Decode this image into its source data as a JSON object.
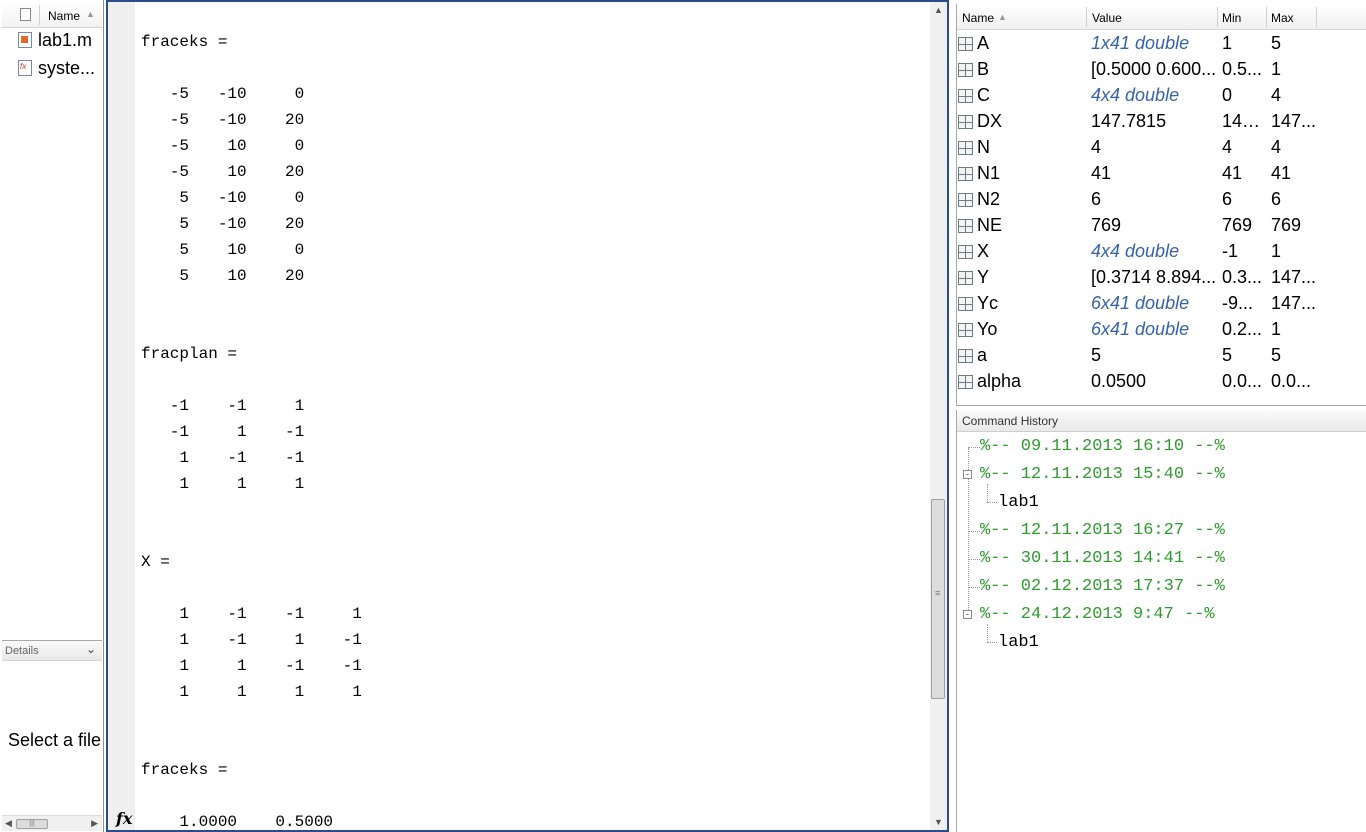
{
  "current_folder": {
    "header": {
      "name_col": "Name",
      "sort_arrow": "▲"
    },
    "files": [
      {
        "name": "lab1.m",
        "icon": "m-file-icon"
      },
      {
        "name": "syste...",
        "icon": "function-file-icon"
      }
    ],
    "details": {
      "label": "Details",
      "chevron": "⌄",
      "message": "Select a file"
    },
    "hscroll": {
      "left_arrow": "◀",
      "right_arrow": "▶",
      "grip": "|||"
    }
  },
  "command_window": {
    "prompt_icon": "fx",
    "lines": [
      {
        "text": "fraceks ="
      },
      {
        "text": "   -5   -10     0"
      },
      {
        "text": "   -5   -10    20"
      },
      {
        "text": "   -5    10     0"
      },
      {
        "text": "   -5    10    20"
      },
      {
        "text": "    5   -10     0"
      },
      {
        "text": "    5   -10    20"
      },
      {
        "text": "    5    10     0"
      },
      {
        "text": "    5    10    20"
      },
      {
        "text": "fracplan ="
      },
      {
        "text": "   -1    -1     1"
      },
      {
        "text": "   -1     1    -1"
      },
      {
        "text": "    1    -1    -1"
      },
      {
        "text": "    1     1     1"
      },
      {
        "text": "X ="
      },
      {
        "text": "    1    -1    -1     1"
      },
      {
        "text": "    1    -1     1    -1"
      },
      {
        "text": "    1     1    -1    -1"
      },
      {
        "text": "    1     1     1     1"
      },
      {
        "text": "fraceks ="
      },
      {
        "text": "    1.0000    0.5000"
      }
    ],
    "scroll": {
      "up": "▲",
      "down": "▼",
      "grip": "≡"
    }
  },
  "workspace": {
    "columns": [
      "Name",
      "Value",
      "Min",
      "Max"
    ],
    "sort_arrow": "▲",
    "variables": [
      {
        "name": "A",
        "value": "1x41 double",
        "min": "1",
        "max": "5",
        "italic": true
      },
      {
        "name": "B",
        "value": "[0.5000 0.600...",
        "min": "0.5...",
        "max": "1",
        "italic": false
      },
      {
        "name": "C",
        "value": "4x4 double",
        "min": "0",
        "max": "4",
        "italic": true
      },
      {
        "name": "DX",
        "value": "147.7815",
        "min": "147...",
        "max": "147...",
        "italic": false
      },
      {
        "name": "N",
        "value": "4",
        "min": "4",
        "max": "4",
        "italic": false
      },
      {
        "name": "N1",
        "value": "41",
        "min": "41",
        "max": "41",
        "italic": false
      },
      {
        "name": "N2",
        "value": "6",
        "min": "6",
        "max": "6",
        "italic": false
      },
      {
        "name": "NE",
        "value": "769",
        "min": "769",
        "max": "769",
        "italic": false
      },
      {
        "name": "X",
        "value": "4x4 double",
        "min": "-1",
        "max": "1",
        "italic": true
      },
      {
        "name": "Y",
        "value": "[0.3714 8.894...",
        "min": "0.3...",
        "max": "147...",
        "italic": false
      },
      {
        "name": "Yc",
        "value": "6x41 double",
        "min": "-9...",
        "max": "147...",
        "italic": true
      },
      {
        "name": "Yo",
        "value": "6x41 double",
        "min": "0.2...",
        "max": "1",
        "italic": true
      },
      {
        "name": "a",
        "value": "5",
        "min": "5",
        "max": "5",
        "italic": false
      },
      {
        "name": "alpha",
        "value": "0.0500",
        "min": "0.0...",
        "max": "0.0...",
        "italic": false
      }
    ]
  },
  "command_history": {
    "title": "Command History",
    "entries": [
      {
        "type": "session",
        "text": "%-- 09.11.2013 16:10 --%"
      },
      {
        "type": "session",
        "text": "%-- 12.11.2013 15:40 --%",
        "expanded": true
      },
      {
        "type": "command",
        "text": "lab1"
      },
      {
        "type": "session",
        "text": "%-- 12.11.2013 16:27 --%"
      },
      {
        "type": "session",
        "text": "%-- 30.11.2013 14:41 --%"
      },
      {
        "type": "session",
        "text": "%-- 02.12.2013 17:37 --%"
      },
      {
        "type": "session",
        "text": "%-- 24.12.2013 9:47 --%",
        "expanded": true
      },
      {
        "type": "command",
        "text": "lab1"
      }
    ],
    "toggle_symbol": "-"
  }
}
